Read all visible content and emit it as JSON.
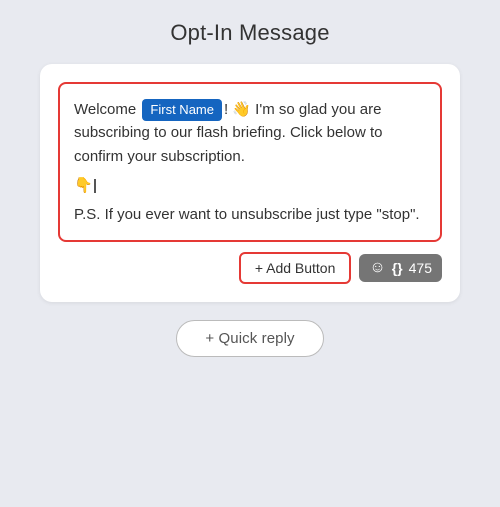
{
  "page": {
    "title": "Opt-In Message",
    "background": "#e8eaf0"
  },
  "message": {
    "line1_before": "Welcome ",
    "badge": "First Name",
    "line1_after": "! 👋 I'm so glad you are subscribing to our flash briefing. Click below to confirm your subscription.",
    "line2": "👇",
    "line3": "P.S. If you ever want to unsubscribe just type \"stop\"."
  },
  "actions": {
    "add_button_label": "+ Add Button",
    "emoji_icon": "☺",
    "brace_icon": "{}",
    "char_count": "475"
  },
  "quick_reply": {
    "label": "+ Quick reply"
  }
}
